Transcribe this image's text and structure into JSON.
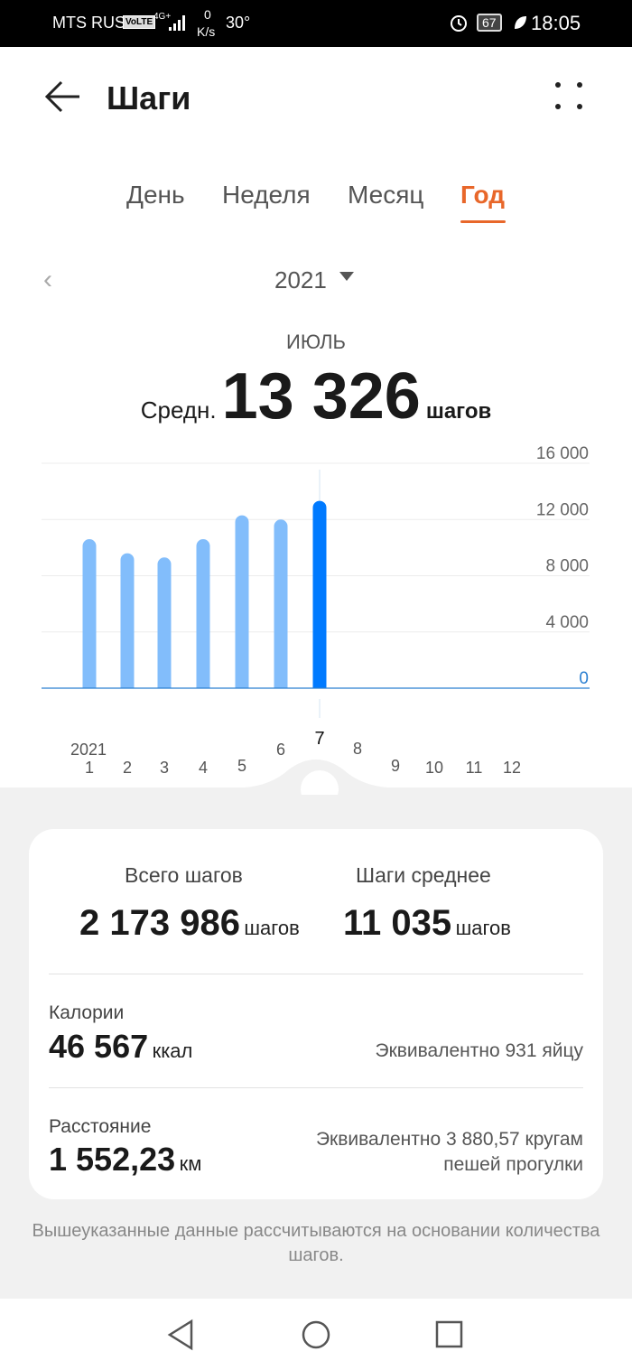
{
  "status_bar": {
    "carrier": "MTS RUS",
    "volte": "VoLTE",
    "network": "4G+",
    "speed_value": "0",
    "speed_unit": "K/s",
    "temperature": "30°",
    "battery": "67",
    "time": "18:05"
  },
  "header": {
    "title": "Шаги"
  },
  "tabs": [
    {
      "label": "День"
    },
    {
      "label": "Неделя"
    },
    {
      "label": "Месяц"
    },
    {
      "label": "Год",
      "active": true
    }
  ],
  "period": {
    "year": "2021"
  },
  "summary": {
    "month": "ИЮЛЬ",
    "avg_label": "Средн.",
    "avg_value": "13 326",
    "avg_unit": "шагов"
  },
  "chart_data": {
    "type": "bar",
    "categories": [
      "1",
      "2",
      "3",
      "4",
      "5",
      "6",
      "7",
      "8",
      "9",
      "10",
      "11",
      "12"
    ],
    "category_year_label": "2021",
    "values": [
      10600,
      9600,
      9300,
      10600,
      12300,
      12000,
      13326,
      null,
      null,
      null,
      null,
      null
    ],
    "selected_index": 6,
    "ylim": [
      0,
      16000
    ],
    "yticks": [
      "0",
      "4 000",
      "8 000",
      "12 000",
      "16 000"
    ],
    "ytick_values": [
      0,
      4000,
      8000,
      12000,
      16000
    ],
    "grid": true,
    "colors": {
      "bar": "#82bdfb",
      "selected": "#007aff",
      "baseline": "#2a7fd1"
    }
  },
  "stats": {
    "total_label": "Всего шагов",
    "total_value": "2 173 986",
    "total_unit": "шагов",
    "avg_label": "Шаги среднее",
    "avg_value": "11 035",
    "avg_unit": "шагов",
    "cal_label": "Калории",
    "cal_value": "46 567",
    "cal_unit": "ккал",
    "cal_eq": "Эквивалентно 931 яйцу",
    "dist_label": "Расстояние",
    "dist_value": "1 552,23",
    "dist_unit": "км",
    "dist_eq1": "Эквивалентно 3 880,57 кругам",
    "dist_eq2": "пешей прогулки"
  },
  "note": "Вышеуказанные данные рассчитываются на основании количества шагов."
}
